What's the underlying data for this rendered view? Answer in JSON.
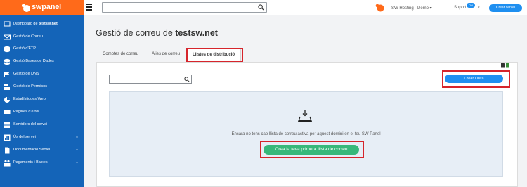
{
  "app": {
    "logo_text": "swpanel",
    "brand_color": "#ff6a1a",
    "sidebar_color": "#1464b8"
  },
  "sidebar": {
    "items": [
      {
        "label": "Dashboard de ",
        "bold": "testsw.net",
        "icon": "dashboard-icon",
        "chevron": false
      },
      {
        "label": "Gestió de Correu",
        "icon": "mail-icon",
        "chevron": false
      },
      {
        "label": "Gestió d'FTP",
        "icon": "ftp-icon",
        "chevron": false
      },
      {
        "label": "Gestió Bases de Dades",
        "icon": "database-icon",
        "chevron": false
      },
      {
        "label": "Gestió de DNS",
        "icon": "flag-icon",
        "chevron": false
      },
      {
        "label": "Gestió de Permisos",
        "icon": "permissions-icon",
        "chevron": false
      },
      {
        "label": "Estadístiques Web",
        "icon": "pie-chart-icon",
        "chevron": false
      },
      {
        "label": "Pàgines d'error",
        "icon": "monitor-icon",
        "chevron": false
      },
      {
        "label": "Servidors del servei",
        "icon": "servers-icon",
        "chevron": false
      },
      {
        "label": "Ús del servei",
        "icon": "usage-icon",
        "chevron": true
      },
      {
        "label": "Documentació Servei",
        "icon": "document-icon",
        "chevron": true
      },
      {
        "label": "Pagaments i Baixes",
        "icon": "payments-icon",
        "chevron": true
      }
    ]
  },
  "topbar": {
    "search_placeholder": "",
    "account": "SW Hosting - Demo",
    "suport": "Suport",
    "suport_badge": "ON",
    "create_service": "Crear servei"
  },
  "page": {
    "title_prefix": "Gestió de correu de ",
    "title_domain": "testsw.net"
  },
  "tabs": {
    "items": [
      "Comptes de correu",
      "Àlies de correu",
      "Llistes de distribució"
    ],
    "active_index": 2
  },
  "lists": {
    "search_placeholder": "",
    "create_button": "Crear Llista",
    "empty_message": "Encara no tens cap llista de correu activa per aquest domini en el teu SW Panel",
    "empty_button": "Crea la teva primera llista de correu"
  },
  "colors": {
    "accent_blue": "#1f8ff0",
    "success_green": "#37b87a",
    "highlight_red": "#d6252c"
  }
}
